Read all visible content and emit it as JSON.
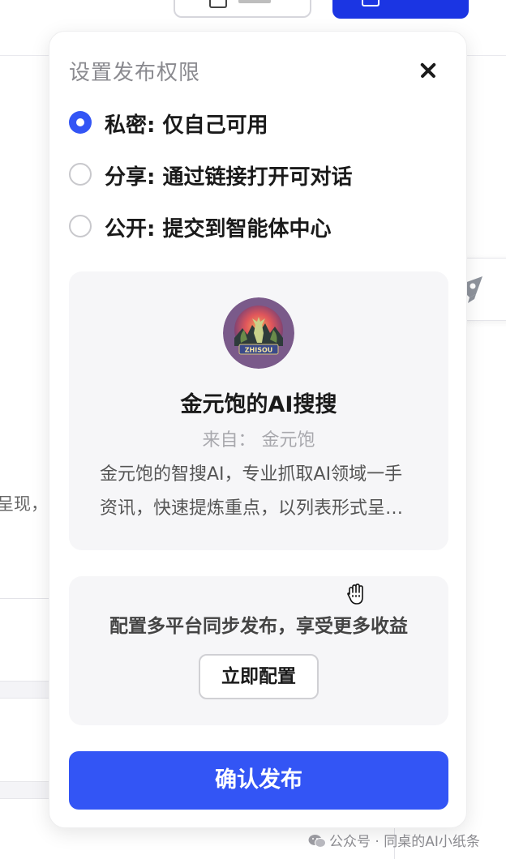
{
  "popover": {
    "title": "设置发布权限",
    "options": [
      {
        "label": "私密: 仅自己可用",
        "checked": true
      },
      {
        "label": "分享: 通过链接打开可对话",
        "checked": false
      },
      {
        "label": "公开: 提交到智能体中心",
        "checked": false
      }
    ],
    "agent": {
      "avatar_text": "ZHISOU",
      "name": "金元饱的AI搜搜",
      "from": "来自： 金元饱",
      "description": "金元饱的智搜AI，专业抓取AI领域一手资讯，快速提炼重点，以列表形式呈现，"
    },
    "sync": {
      "text": "配置多平台同步发布，享受更多收益",
      "button_label": "立即配置"
    },
    "confirm_label": "确认发布"
  },
  "background": {
    "left_text": "呈现，"
  },
  "watermark": "公众号 · 同桌的AI小纸条",
  "colors": {
    "accent": "#3355f5",
    "header_primary": "#1b35e3"
  }
}
